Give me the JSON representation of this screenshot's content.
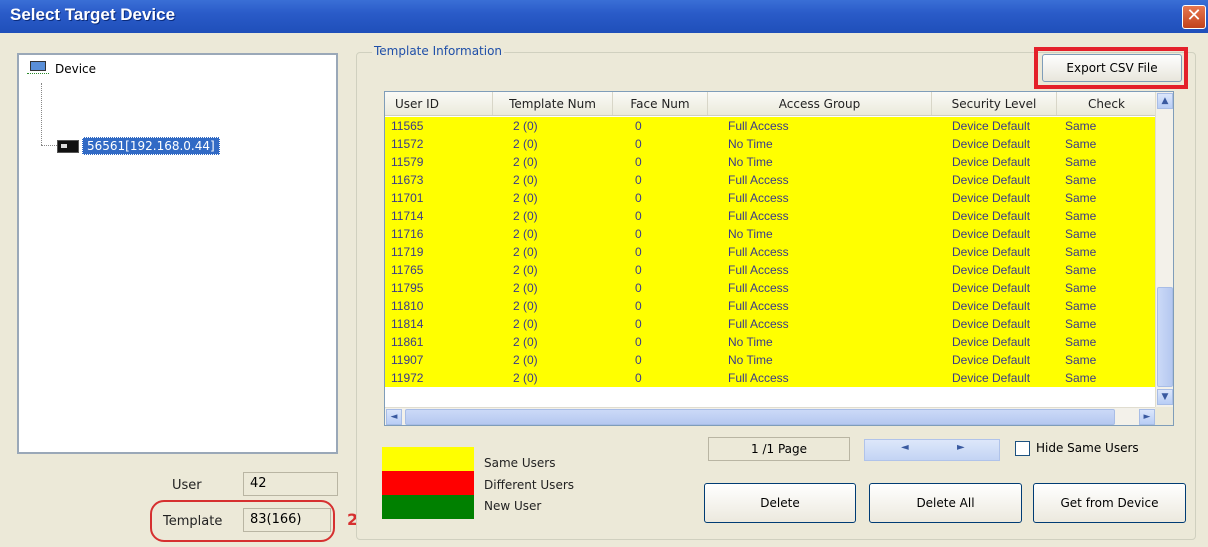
{
  "window": {
    "title": "Select Target Device",
    "close_glyph": "✕"
  },
  "tree": {
    "root_label": "Device",
    "root_icon": "network-computer-icon",
    "child_label": "56561[192.168.0.44]",
    "child_icon": "device-terminal-icon"
  },
  "counts": {
    "user_label": "User",
    "user_value": "42",
    "template_label": "Template",
    "template_value": "83(166)",
    "annotation_number": "2"
  },
  "template_info": {
    "group_title": "Template Information",
    "export_label": "Export CSV File",
    "columns": [
      "User ID",
      "Template Num",
      "Face Num",
      "Access Group",
      "Security Level",
      "Check"
    ],
    "rows": [
      [
        "11565",
        "2 (0)",
        "0",
        "Full Access",
        "Device Default",
        "Same"
      ],
      [
        "11572",
        "2 (0)",
        "0",
        "No Time",
        "Device Default",
        "Same"
      ],
      [
        "11579",
        "2 (0)",
        "0",
        "No Time",
        "Device Default",
        "Same"
      ],
      [
        "11673",
        "2 (0)",
        "0",
        "Full Access",
        "Device Default",
        "Same"
      ],
      [
        "11701",
        "2 (0)",
        "0",
        "Full Access",
        "Device Default",
        "Same"
      ],
      [
        "11714",
        "2 (0)",
        "0",
        "Full Access",
        "Device Default",
        "Same"
      ],
      [
        "11716",
        "2 (0)",
        "0",
        "No Time",
        "Device Default",
        "Same"
      ],
      [
        "11719",
        "2 (0)",
        "0",
        "Full Access",
        "Device Default",
        "Same"
      ],
      [
        "11765",
        "2 (0)",
        "0",
        "Full Access",
        "Device Default",
        "Same"
      ],
      [
        "11795",
        "2 (0)",
        "0",
        "Full Access",
        "Device Default",
        "Same"
      ],
      [
        "11810",
        "2 (0)",
        "0",
        "Full Access",
        "Device Default",
        "Same"
      ],
      [
        "11814",
        "2 (0)",
        "0",
        "Full Access",
        "Device Default",
        "Same"
      ],
      [
        "11861",
        "2 (0)",
        "0",
        "No Time",
        "Device Default",
        "Same"
      ],
      [
        "11907",
        "2 (0)",
        "0",
        "No Time",
        "Device Default",
        "Same"
      ],
      [
        "11972",
        "2 (0)",
        "0",
        "Full Access",
        "Device Default",
        "Same"
      ]
    ]
  },
  "legend": [
    {
      "label": "Same Users",
      "color": "#ffff00"
    },
    {
      "label": "Different Users",
      "color": "#ff0000"
    },
    {
      "label": "New User",
      "color": "#008000"
    }
  ],
  "pager": {
    "page_text": "1 /1 Page",
    "prev_glyph": "◄",
    "next_glyph": "►",
    "hide_same_label": "Hide Same Users",
    "hide_same_checked": false
  },
  "buttons": {
    "delete": "Delete",
    "delete_all": "Delete All",
    "get_from_device": "Get from Device"
  },
  "scroll": {
    "up": "▲",
    "down": "▼",
    "left": "◄",
    "right": "►"
  },
  "colors": {
    "row_same": "#ffff00",
    "highlight": "#e4202a",
    "title_bar": "#2a5bc8"
  }
}
